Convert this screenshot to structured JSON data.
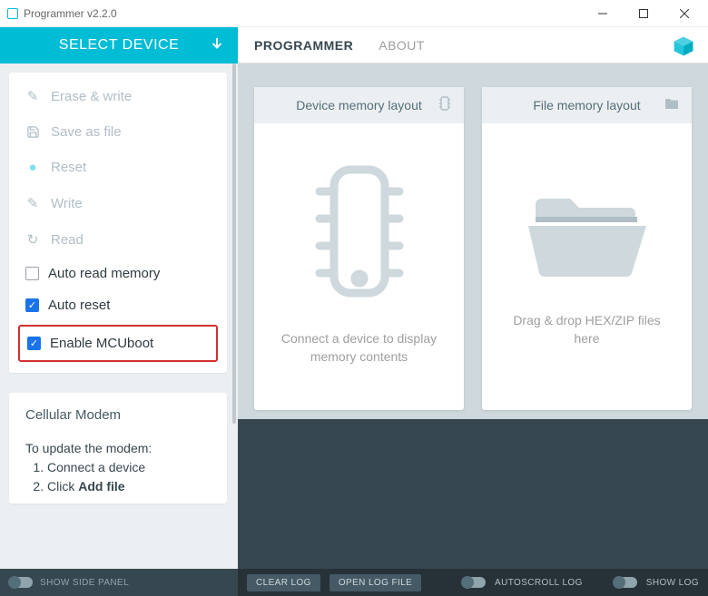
{
  "window": {
    "title": "Programmer v2.2.0"
  },
  "sidebar": {
    "select_device": "SELECT DEVICE",
    "actions": {
      "erase_write": "Erase & write",
      "save_as_file": "Save as file",
      "reset": "Reset",
      "write": "Write",
      "read": "Read"
    },
    "checks": {
      "auto_read": {
        "label": "Auto read memory",
        "checked": false
      },
      "auto_reset": {
        "label": "Auto reset",
        "checked": true
      },
      "enable_mcuboot": {
        "label": "Enable MCUboot",
        "checked": true
      }
    },
    "modem": {
      "title": "Cellular Modem",
      "intro": "To update the modem:",
      "step1": "Connect a device",
      "step2_prefix": "Click ",
      "step2_bold": "Add file"
    },
    "show_side_panel": "SHOW SIDE PANEL"
  },
  "topnav": {
    "tabs": {
      "programmer": "PROGRAMMER",
      "about": "ABOUT"
    }
  },
  "cards": {
    "device": {
      "title": "Device memory layout",
      "msg": "Connect a device to display memory contents"
    },
    "file": {
      "title": "File memory layout",
      "msg": "Drag & drop HEX/ZIP files here"
    }
  },
  "bottom": {
    "clear_log": "CLEAR LOG",
    "open_log_file": "OPEN LOG FILE",
    "autoscroll": "AUTOSCROLL LOG",
    "show_log": "SHOW LOG"
  }
}
